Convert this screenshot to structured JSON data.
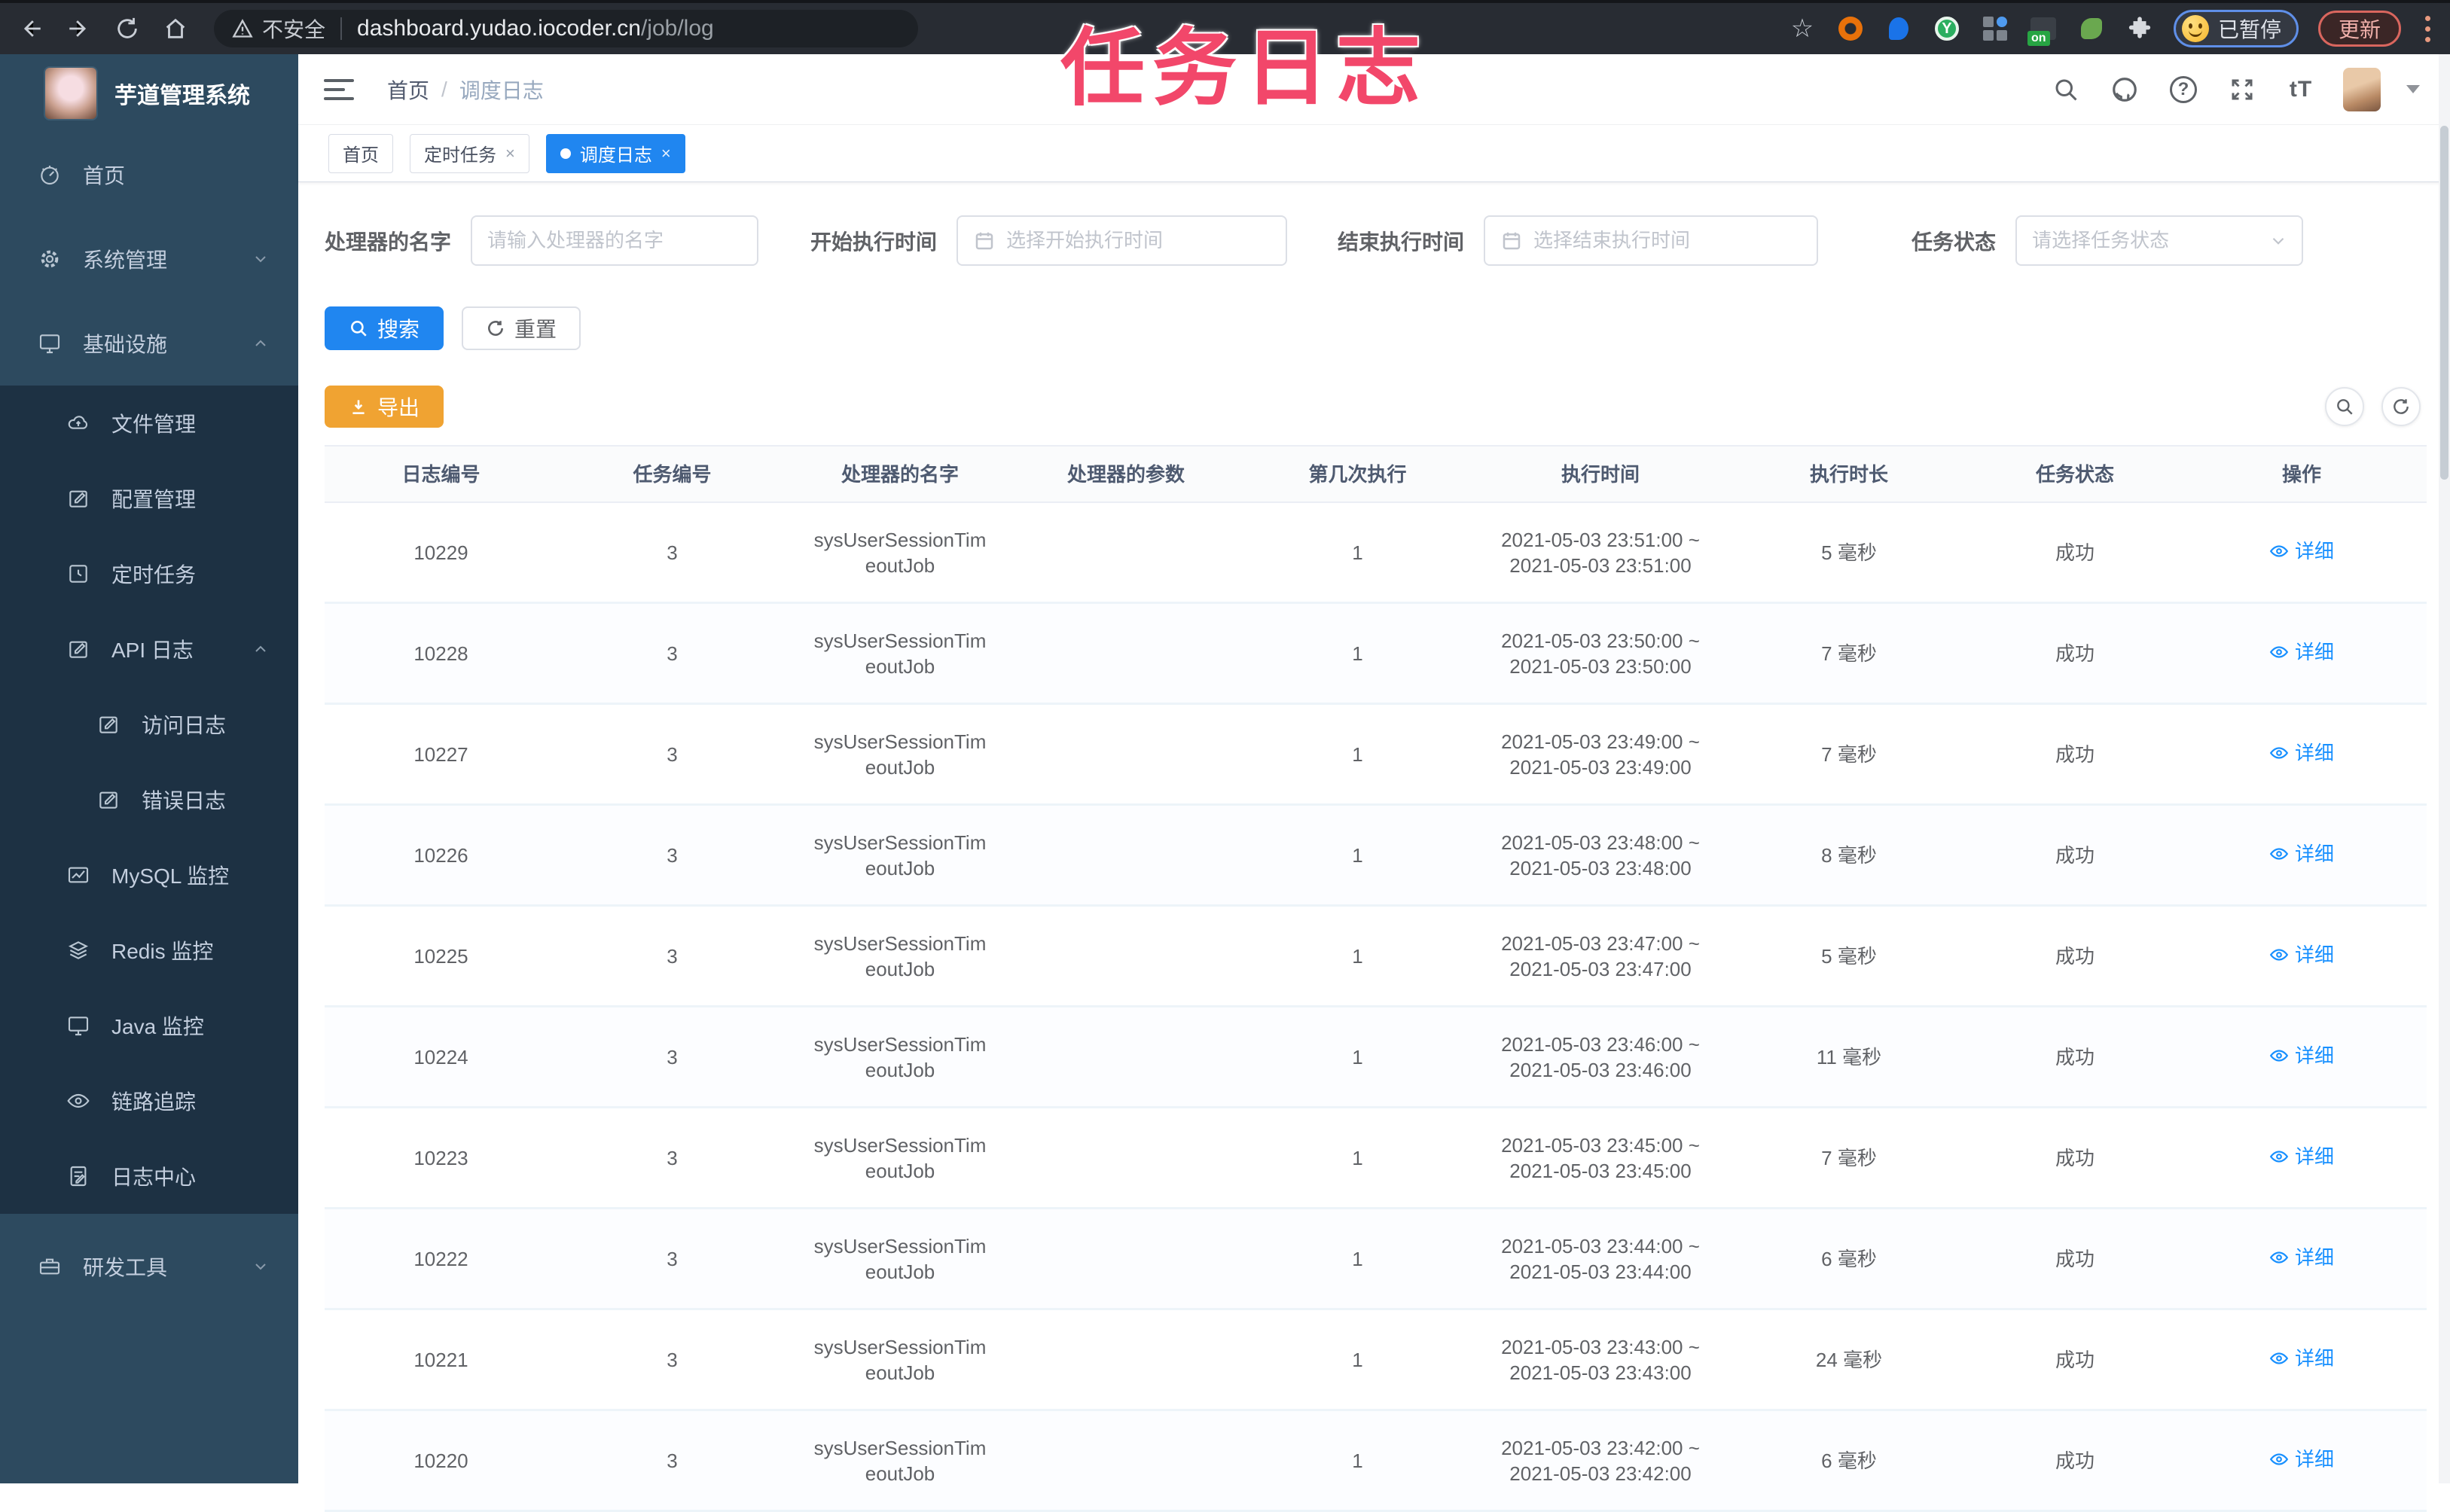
{
  "browser": {
    "security_label": "不安全",
    "url_host": "dashboard.yudao.iocoder.cn",
    "url_path": "/job/log",
    "extension_badge": "on",
    "extension_letter": "Y",
    "profile_status": "已暂停",
    "update_label": "更新"
  },
  "annotation": {
    "title": "任务日志"
  },
  "sidebar": {
    "app_title": "芋道管理系统",
    "items": [
      {
        "label": "首页",
        "icon": "dashboard",
        "level": 0,
        "dark": false,
        "arrow": ""
      },
      {
        "label": "系统管理",
        "icon": "gear",
        "level": 0,
        "dark": false,
        "arrow": "down"
      },
      {
        "label": "基础设施",
        "icon": "monitor",
        "level": 0,
        "dark": false,
        "arrow": "up"
      },
      {
        "label": "文件管理",
        "icon": "cloud",
        "level": 1,
        "dark": true,
        "arrow": ""
      },
      {
        "label": "配置管理",
        "icon": "edit",
        "level": 1,
        "dark": true,
        "arrow": ""
      },
      {
        "label": "定时任务",
        "icon": "clock",
        "level": 1,
        "dark": true,
        "arrow": ""
      },
      {
        "label": "API 日志",
        "icon": "edit",
        "level": 1,
        "dark": true,
        "arrow": "up"
      },
      {
        "label": "访问日志",
        "icon": "edit",
        "level": 2,
        "dark": true,
        "arrow": ""
      },
      {
        "label": "错误日志",
        "icon": "edit",
        "level": 2,
        "dark": true,
        "arrow": ""
      },
      {
        "label": "MySQL 监控",
        "icon": "chart",
        "level": 1,
        "dark": true,
        "arrow": ""
      },
      {
        "label": "Redis 监控",
        "icon": "layers",
        "level": 1,
        "dark": true,
        "arrow": ""
      },
      {
        "label": "Java 监控",
        "icon": "monitor",
        "level": 1,
        "dark": true,
        "arrow": ""
      },
      {
        "label": "链路追踪",
        "icon": "eye",
        "level": 1,
        "dark": true,
        "arrow": ""
      },
      {
        "label": "日志中心",
        "icon": "doc",
        "level": 1,
        "dark": true,
        "arrow": ""
      },
      {
        "label": "研发工具",
        "icon": "toolbox",
        "level": 0,
        "dark": false,
        "arrow": "down",
        "gapTop": true
      }
    ]
  },
  "header": {
    "breadcrumb_home": "首页",
    "breadcrumb_sep": "/",
    "breadcrumb_current": "调度日志",
    "font_size_icon_label": "tT"
  },
  "tags": {
    "items": [
      {
        "label": "首页"
      },
      {
        "label": "定时任务"
      },
      {
        "label": "调度日志"
      }
    ]
  },
  "filters": {
    "name": {
      "label": "处理器的名字",
      "placeholder": "请输入处理器的名字"
    },
    "start": {
      "label": "开始执行时间",
      "placeholder": "选择开始执行时间"
    },
    "end": {
      "label": "结束执行时间",
      "placeholder": "选择结束执行时间"
    },
    "status": {
      "label": "任务状态",
      "placeholder": "请选择任务状态"
    }
  },
  "actions": {
    "search": "搜索",
    "reset": "重置",
    "export": "导出"
  },
  "table": {
    "columns": [
      "日志编号",
      "任务编号",
      "处理器的名字",
      "处理器的参数",
      "第几次执行",
      "执行时间",
      "执行时长",
      "任务状态",
      "操作"
    ],
    "detail_label": "详细",
    "rows": [
      {
        "log_id": "10229",
        "job_id": "3",
        "handler1": "sysUserSessionTim",
        "handler2": "eoutJob",
        "param": "",
        "seq": "1",
        "time1": "2021-05-03 23:51:00 ~",
        "time2": "2021-05-03 23:51:00",
        "duration": "5 毫秒",
        "status": "成功"
      },
      {
        "log_id": "10228",
        "job_id": "3",
        "handler1": "sysUserSessionTim",
        "handler2": "eoutJob",
        "param": "",
        "seq": "1",
        "time1": "2021-05-03 23:50:00 ~",
        "time2": "2021-05-03 23:50:00",
        "duration": "7 毫秒",
        "status": "成功"
      },
      {
        "log_id": "10227",
        "job_id": "3",
        "handler1": "sysUserSessionTim",
        "handler2": "eoutJob",
        "param": "",
        "seq": "1",
        "time1": "2021-05-03 23:49:00 ~",
        "time2": "2021-05-03 23:49:00",
        "duration": "7 毫秒",
        "status": "成功"
      },
      {
        "log_id": "10226",
        "job_id": "3",
        "handler1": "sysUserSessionTim",
        "handler2": "eoutJob",
        "param": "",
        "seq": "1",
        "time1": "2021-05-03 23:48:00 ~",
        "time2": "2021-05-03 23:48:00",
        "duration": "8 毫秒",
        "status": "成功"
      },
      {
        "log_id": "10225",
        "job_id": "3",
        "handler1": "sysUserSessionTim",
        "handler2": "eoutJob",
        "param": "",
        "seq": "1",
        "time1": "2021-05-03 23:47:00 ~",
        "time2": "2021-05-03 23:47:00",
        "duration": "5 毫秒",
        "status": "成功"
      },
      {
        "log_id": "10224",
        "job_id": "3",
        "handler1": "sysUserSessionTim",
        "handler2": "eoutJob",
        "param": "",
        "seq": "1",
        "time1": "2021-05-03 23:46:00 ~",
        "time2": "2021-05-03 23:46:00",
        "duration": "11 毫秒",
        "status": "成功"
      },
      {
        "log_id": "10223",
        "job_id": "3",
        "handler1": "sysUserSessionTim",
        "handler2": "eoutJob",
        "param": "",
        "seq": "1",
        "time1": "2021-05-03 23:45:00 ~",
        "time2": "2021-05-03 23:45:00",
        "duration": "7 毫秒",
        "status": "成功"
      },
      {
        "log_id": "10222",
        "job_id": "3",
        "handler1": "sysUserSessionTim",
        "handler2": "eoutJob",
        "param": "",
        "seq": "1",
        "time1": "2021-05-03 23:44:00 ~",
        "time2": "2021-05-03 23:44:00",
        "duration": "6 毫秒",
        "status": "成功"
      },
      {
        "log_id": "10221",
        "job_id": "3",
        "handler1": "sysUserSessionTim",
        "handler2": "eoutJob",
        "param": "",
        "seq": "1",
        "time1": "2021-05-03 23:43:00 ~",
        "time2": "2021-05-03 23:43:00",
        "duration": "24 毫秒",
        "status": "成功"
      },
      {
        "log_id": "10220",
        "job_id": "3",
        "handler1": "sysUserSessionTim",
        "handler2": "eoutJob",
        "param": "",
        "seq": "1",
        "time1": "2021-05-03 23:42:00 ~",
        "time2": "2021-05-03 23:42:00",
        "duration": "6 毫秒",
        "status": "成功"
      }
    ]
  },
  "colors": {
    "accent_blue": "#2086f0",
    "link_blue": "#1890ff",
    "warning_orange": "#f0a332",
    "sidebar_bg": "#2d4a5f",
    "sidebar_submenu_bg": "#1d3143",
    "annotation_pink": "#f2476a",
    "chrome_bg": "#282c33"
  }
}
